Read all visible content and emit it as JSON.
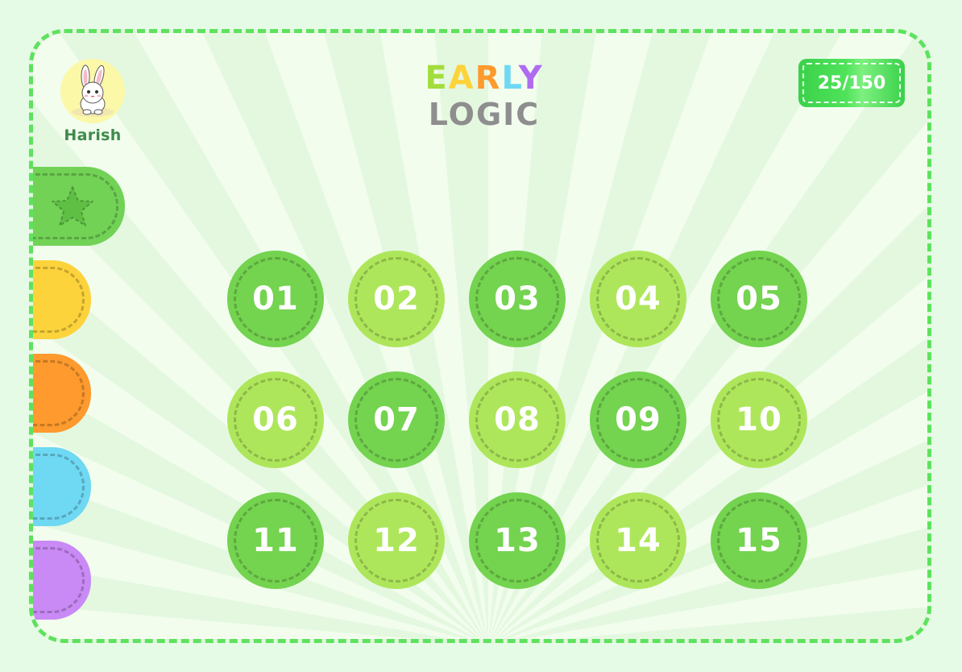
{
  "player": {
    "name": "Harish",
    "avatar_icon": "bunny-icon"
  },
  "title": {
    "top_letters": [
      {
        "char": "E",
        "color": "#a3dd3d"
      },
      {
        "char": "A",
        "color": "#fdd33c"
      },
      {
        "char": "R",
        "color": "#fe9a2e"
      },
      {
        "char": "L",
        "color": "#6fd8f3"
      },
      {
        "char": "Y",
        "color": "#b06cf0"
      }
    ],
    "bottom": "LOGIC"
  },
  "progress": {
    "label": "25/150"
  },
  "categories": [
    {
      "name": "favorites",
      "icon": "star-icon",
      "color": "#72d256"
    },
    {
      "name": "yellow",
      "color": "#fdd33c"
    },
    {
      "name": "orange",
      "color": "#fe9a2e"
    },
    {
      "name": "blue",
      "color": "#6fd8f3"
    },
    {
      "name": "purple",
      "color": "#c98af5"
    }
  ],
  "levels": [
    {
      "label": "01",
      "shade": "dark"
    },
    {
      "label": "02",
      "shade": "light"
    },
    {
      "label": "03",
      "shade": "dark"
    },
    {
      "label": "04",
      "shade": "light"
    },
    {
      "label": "05",
      "shade": "dark"
    },
    {
      "label": "06",
      "shade": "light"
    },
    {
      "label": "07",
      "shade": "dark"
    },
    {
      "label": "08",
      "shade": "light"
    },
    {
      "label": "09",
      "shade": "dark"
    },
    {
      "label": "10",
      "shade": "light"
    },
    {
      "label": "11",
      "shade": "dark"
    },
    {
      "label": "12",
      "shade": "light"
    },
    {
      "label": "13",
      "shade": "dark"
    },
    {
      "label": "14",
      "shade": "light"
    },
    {
      "label": "15",
      "shade": "dark"
    }
  ],
  "colors": {
    "background": "#e6fbe6",
    "frame_border": "#5ee25e",
    "level_dark": "#74d34f",
    "level_light": "#aee65b"
  }
}
